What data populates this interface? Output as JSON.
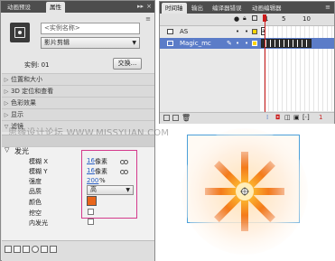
{
  "props_panel": {
    "tabs": [
      "动画预设",
      "属性"
    ],
    "instance_name_placeholder": "<实例名称>",
    "symbol_type": "影片剪辑",
    "instance_label": "实例: 01",
    "swap_button": "交换...",
    "sections": [
      "位置和大小",
      "3D 定位和查看",
      "色彩效果",
      "显示",
      "滤镜"
    ],
    "filter_name": "发光",
    "blur_x_label": "模糊 X",
    "blur_x_value": "16",
    "blur_y_label": "模糊 Y",
    "blur_y_value": "16",
    "unit_px": "像素",
    "strength_label": "强度",
    "strength_value": "200",
    "percent": "%",
    "quality_label": "品质",
    "quality_value": "高",
    "color_label": "颜色",
    "glow_color": "#e8651a",
    "knockout_label": "挖空",
    "inner_glow_label": "内发光",
    "watermark": "思缘设计论坛 WWW.MISSYUAN.COM"
  },
  "timeline": {
    "tabs": [
      "时间轴",
      "输出",
      "编译器错误",
      "动画编辑器"
    ],
    "frame_numbers": [
      "1",
      "5",
      "10"
    ],
    "layers": [
      {
        "name": "AS",
        "selected": false
      },
      {
        "name": "Magic_mc",
        "selected": true
      }
    ],
    "footer_frame": "1"
  },
  "colors": {
    "highlight_magenta": "#d43a8c",
    "selected_layer": "#5b7cc8",
    "link_blue": "#2a5fc4",
    "playhead_red": "#cc1b1b",
    "stage_border": "#4a9fd9"
  }
}
